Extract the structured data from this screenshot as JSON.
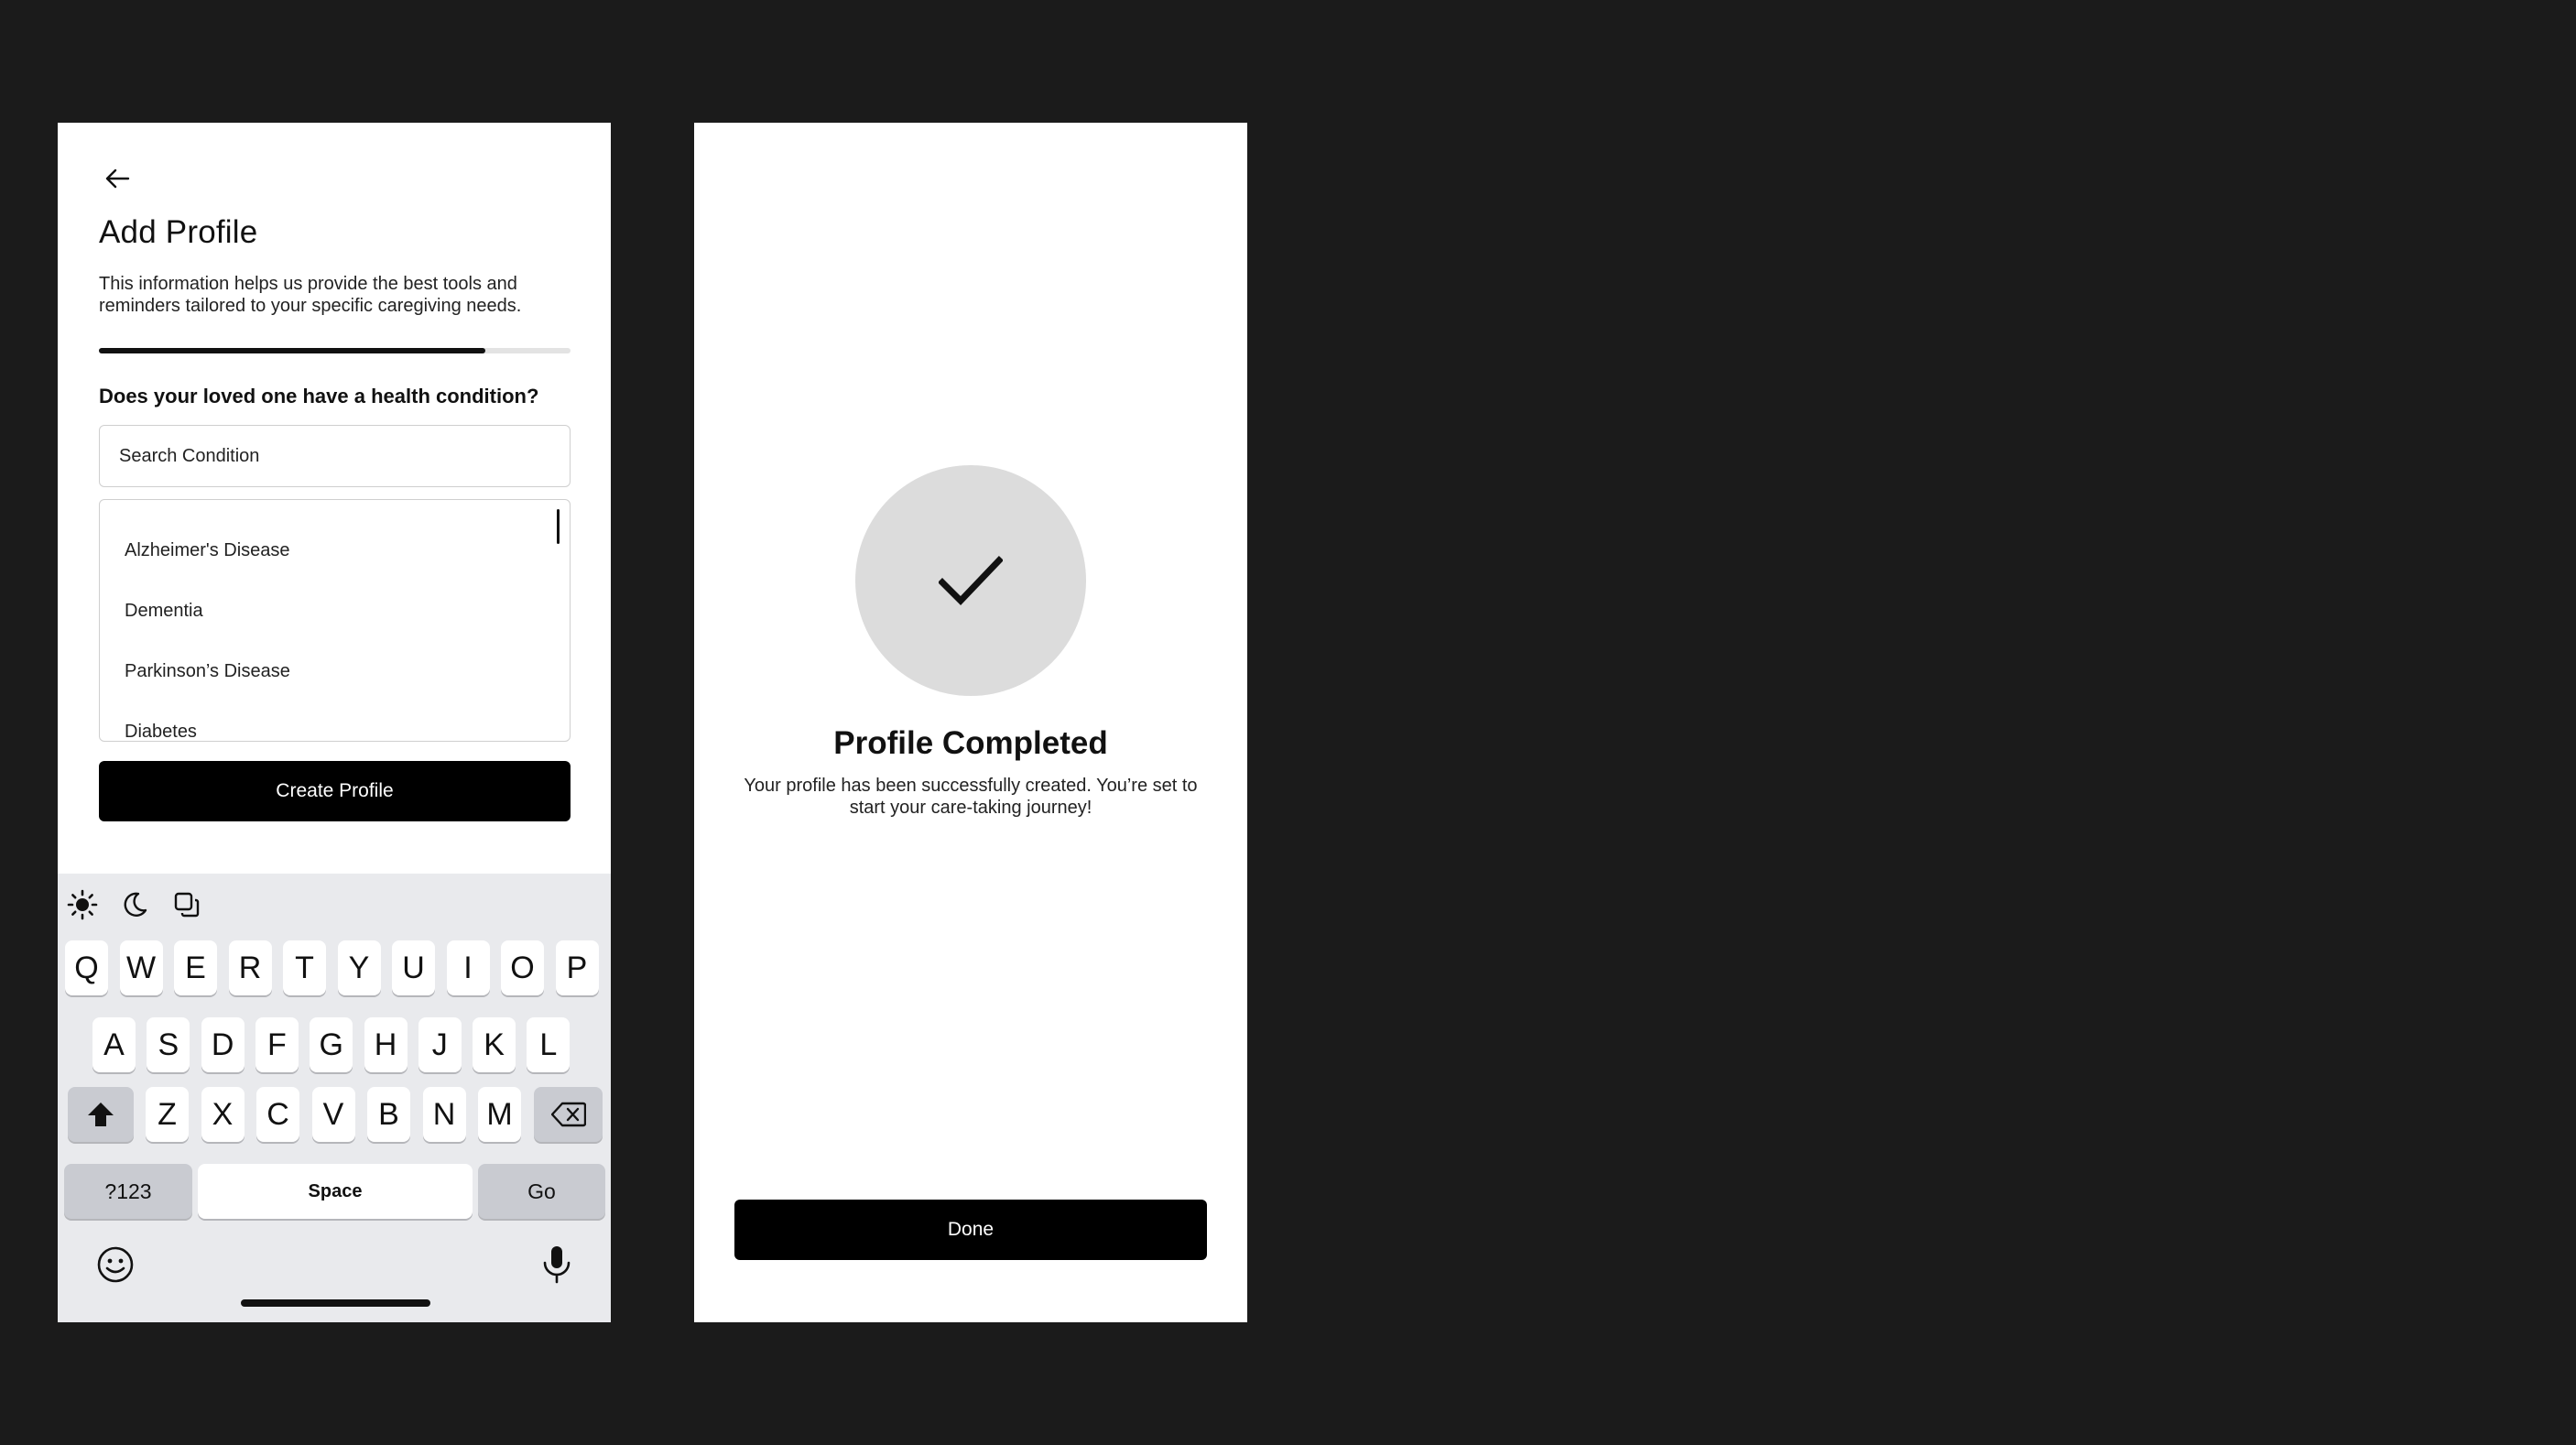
{
  "add_profile": {
    "title": "Add Profile",
    "description": "This information helps us provide the best tools and reminders tailored to your specific caregiving needs.",
    "progress_percent": 82,
    "question": "Does your loved one have a health condition?",
    "search": {
      "placeholder": "Search Condition",
      "value": ""
    },
    "conditions": [
      "Alzheimer's Disease",
      "Dementia",
      "Parkinson’s Disease",
      "Diabetes"
    ],
    "create_button": "Create Profile"
  },
  "keyboard": {
    "row1": [
      "Q",
      "W",
      "E",
      "R",
      "T",
      "Y",
      "U",
      "I",
      "O",
      "P"
    ],
    "row2": [
      "A",
      "S",
      "D",
      "F",
      "G",
      "H",
      "J",
      "K",
      "L"
    ],
    "row3": [
      "Z",
      "X",
      "C",
      "V",
      "B",
      "N",
      "M"
    ],
    "numbers_key": "?123",
    "space_key": "Space",
    "go_key": "Go"
  },
  "profile_completed": {
    "title": "Profile Completed",
    "description": "Your profile has been successfully created. You’re set to start your care-taking journey!",
    "done_button": "Done"
  }
}
